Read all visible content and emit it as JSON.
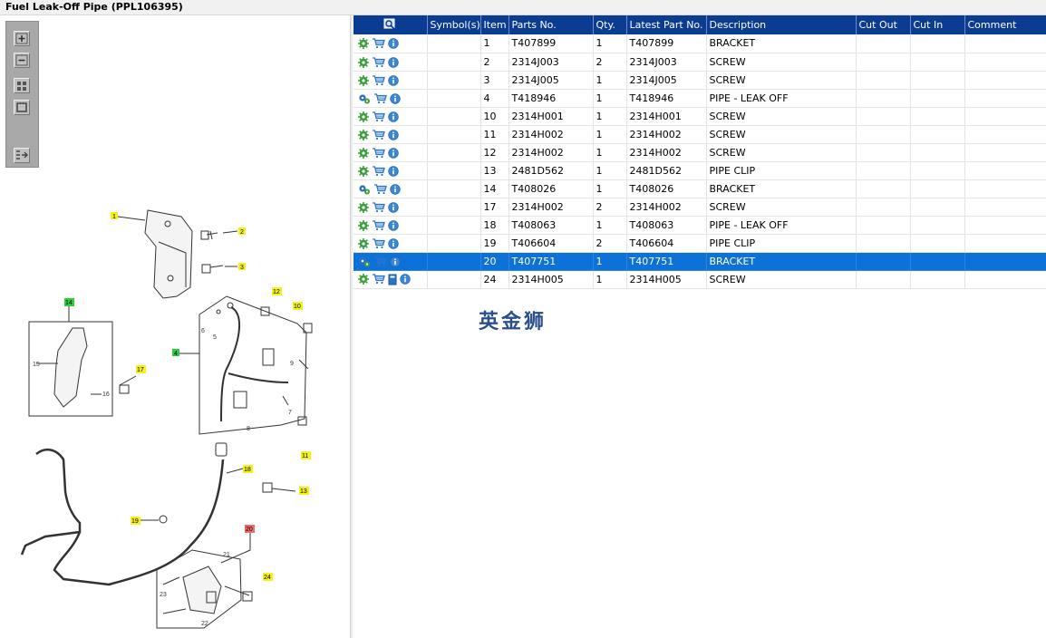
{
  "window": {
    "title": "Fuel Leak-Off Pipe (PPL106395)"
  },
  "toolbar": {
    "zoom_in_icon": "plus-icon",
    "zoom_out_icon": "minus-icon",
    "fit_icon": "grid-icon",
    "actual_size_icon": "square-icon",
    "panel_icon": "list-arrow-icon"
  },
  "diagram": {
    "callouts": [
      "1",
      "2",
      "3",
      "12",
      "10",
      "14",
      "15",
      "16",
      "17",
      "4",
      "6",
      "5",
      "9",
      "7",
      "8",
      "11",
      "18",
      "13",
      "19",
      "20",
      "21",
      "23",
      "24",
      "22"
    ]
  },
  "table": {
    "columns": [
      "",
      "Symbol(s)",
      "Item",
      "Parts No.",
      "Qty.",
      "Latest Part No.",
      "Description",
      "Cut Out",
      "Cut In",
      "Comment"
    ],
    "rows": [
      {
        "item": "1",
        "parts_no": "T407899",
        "qty": "1",
        "latest": "T407899",
        "desc": "BRACKET",
        "icon_type": "gear"
      },
      {
        "item": "2",
        "parts_no": "2314J003",
        "qty": "2",
        "latest": "2314J003",
        "desc": "SCREW",
        "icon_type": "gear"
      },
      {
        "item": "3",
        "parts_no": "2314J005",
        "qty": "1",
        "latest": "2314J005",
        "desc": "SCREW",
        "icon_type": "gear"
      },
      {
        "item": "4",
        "parts_no": "T418946",
        "qty": "1",
        "latest": "T418946",
        "desc": "PIPE - LEAK OFF",
        "icon_type": "gears"
      },
      {
        "item": "10",
        "parts_no": "2314H001",
        "qty": "1",
        "latest": "2314H001",
        "desc": "SCREW",
        "icon_type": "gear"
      },
      {
        "item": "11",
        "parts_no": "2314H002",
        "qty": "1",
        "latest": "2314H002",
        "desc": "SCREW",
        "icon_type": "gear"
      },
      {
        "item": "12",
        "parts_no": "2314H002",
        "qty": "1",
        "latest": "2314H002",
        "desc": "SCREW",
        "icon_type": "gear"
      },
      {
        "item": "13",
        "parts_no": "2481D562",
        "qty": "1",
        "latest": "2481D562",
        "desc": "PIPE CLIP",
        "icon_type": "gear"
      },
      {
        "item": "14",
        "parts_no": "T408026",
        "qty": "1",
        "latest": "T408026",
        "desc": "BRACKET",
        "icon_type": "gears"
      },
      {
        "item": "17",
        "parts_no": "2314H002",
        "qty": "2",
        "latest": "2314H002",
        "desc": "SCREW",
        "icon_type": "gear"
      },
      {
        "item": "18",
        "parts_no": "T408063",
        "qty": "1",
        "latest": "T408063",
        "desc": "PIPE - LEAK OFF",
        "icon_type": "gear"
      },
      {
        "item": "19",
        "parts_no": "T406604",
        "qty": "2",
        "latest": "T406604",
        "desc": "PIPE CLIP",
        "icon_type": "gear"
      },
      {
        "item": "20",
        "parts_no": "T407751",
        "qty": "1",
        "latest": "T407751",
        "desc": "BRACKET",
        "icon_type": "gears",
        "selected": true
      },
      {
        "item": "24",
        "parts_no": "2314H005",
        "qty": "1",
        "latest": "2314H005",
        "desc": "SCREW",
        "icon_type": "gear",
        "extra_icon": "book-icon"
      }
    ]
  },
  "watermark": "英金狮",
  "colors": {
    "header": "#0a3d91",
    "selected_row": "#0d72d8",
    "gear": "#3aa03a",
    "cart": "#2c74c8",
    "info": "#3a86d8",
    "yellow_tag": "#f3f31a",
    "green_tag": "#2ecc40",
    "red_tag": "#ef6b6b"
  }
}
